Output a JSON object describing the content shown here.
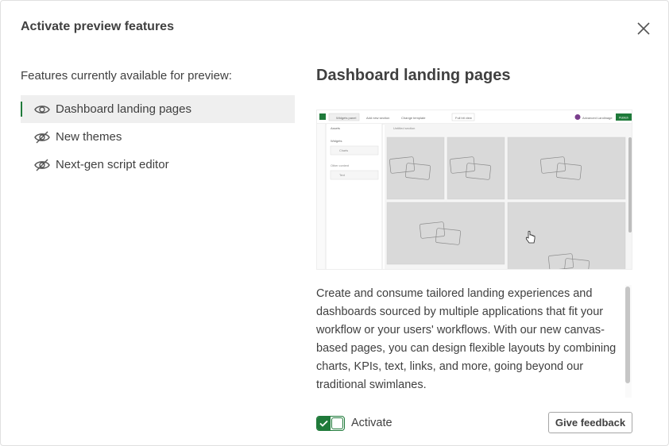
{
  "dialog": {
    "title": "Activate preview features",
    "close_icon": "close-icon"
  },
  "features": {
    "heading": "Features currently available for preview:",
    "items": [
      {
        "label": "Dashboard landing pages",
        "icon": "eye-icon",
        "selected": true
      },
      {
        "label": "New themes",
        "icon": "eye-off-icon",
        "selected": false
      },
      {
        "label": "Next-gen script editor",
        "icon": "eye-off-icon",
        "selected": false
      }
    ]
  },
  "detail": {
    "title": "Dashboard landing pages",
    "description": "Create and consume tailored landing experiences and dashboards sourced by multiple applications that fit your workflow or your users' workflows. With our new canvas-based pages, you can design flexible layouts by combining charts, KPIs, text, links, and more, going beyond our traditional swimlanes.",
    "preview": {
      "toolbar": [
        "Widgets panel",
        "Add new section",
        "Change template",
        "Full bit view"
      ],
      "user": "Advanced Landinage",
      "publish": "Publish",
      "panel_title": "Assets",
      "panel_widgets": "Widgets",
      "panel_charts": "Charts",
      "panel_other": "Other content",
      "panel_text": "Text",
      "section_label": "Untitled section"
    }
  },
  "footer": {
    "toggle_label": "Activate",
    "toggle_on": true,
    "feedback_label": "Give feedback"
  },
  "colors": {
    "accent": "#1f7a3a",
    "selected_bg": "#efefef",
    "text": "#404040"
  }
}
